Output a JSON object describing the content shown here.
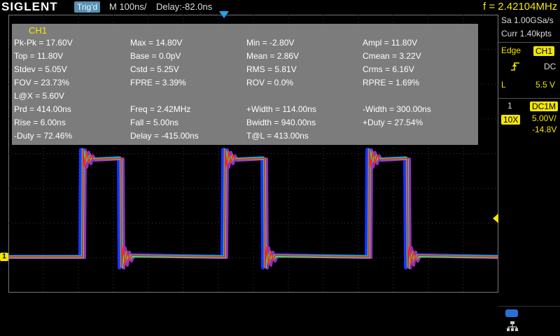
{
  "header": {
    "brand": "SIGLENT",
    "trig_status": "Trig'd",
    "timebase": "M 100ns/",
    "delay": "Delay:-82.0ns",
    "frequency": "f = 2.42104MHz"
  },
  "measurements": {
    "channel": "CH1",
    "rows": [
      [
        "Pk-Pk = 17.60V",
        "Max = 14.80V",
        "Min = -2.80V",
        "Ampl = 11.80V"
      ],
      [
        "Top = 11.80V",
        "Base = 0.0pV",
        "Mean = 2.86V",
        "Cmean = 3.22V"
      ],
      [
        "Stdev = 5.05V",
        "Cstd = 5.25V",
        "RMS = 5.81V",
        "Crms = 6.16V"
      ],
      [
        "FOV = 23.73%",
        "FPRE = 3.39%",
        "ROV = 0.0%",
        "RPRE = 1.69%"
      ],
      [
        "L@X = 5.60V",
        "",
        "",
        ""
      ],
      [
        "Prd = 414.00ns",
        "Freq = 2.42MHz",
        "+Width = 114.00ns",
        "-Width = 300.00ns"
      ],
      [
        "Rise = 6.00ns",
        "Fall = 5.00ns",
        "Bwidth = 940.00ns",
        "+Duty = 27.54%"
      ],
      [
        "-Duty = 72.46%",
        "Delay = -415.00ns",
        "T@L = 413.00ns",
        ""
      ]
    ]
  },
  "acquisition": {
    "sample_rate": "Sa 1.00GSa/s",
    "memory": "Curr 1.40kpts"
  },
  "trigger": {
    "type": "Edge",
    "source": "CH1",
    "slope_icon": "rising-edge-icon",
    "coupling": "DC",
    "level_label": "L",
    "level": "5.5 V"
  },
  "channel1": {
    "number": "1",
    "coupling": "DC1M",
    "probe": "10X",
    "scale": "5.00V/",
    "offset": "-14.8V",
    "marker": "1"
  },
  "colors": {
    "ch1": "#f2e600",
    "accent": "#1aa8ff",
    "grid": "#3a3a3a",
    "panel": "#8a8a8a"
  },
  "icons": [
    "usb-icon",
    "lan-icon"
  ]
}
